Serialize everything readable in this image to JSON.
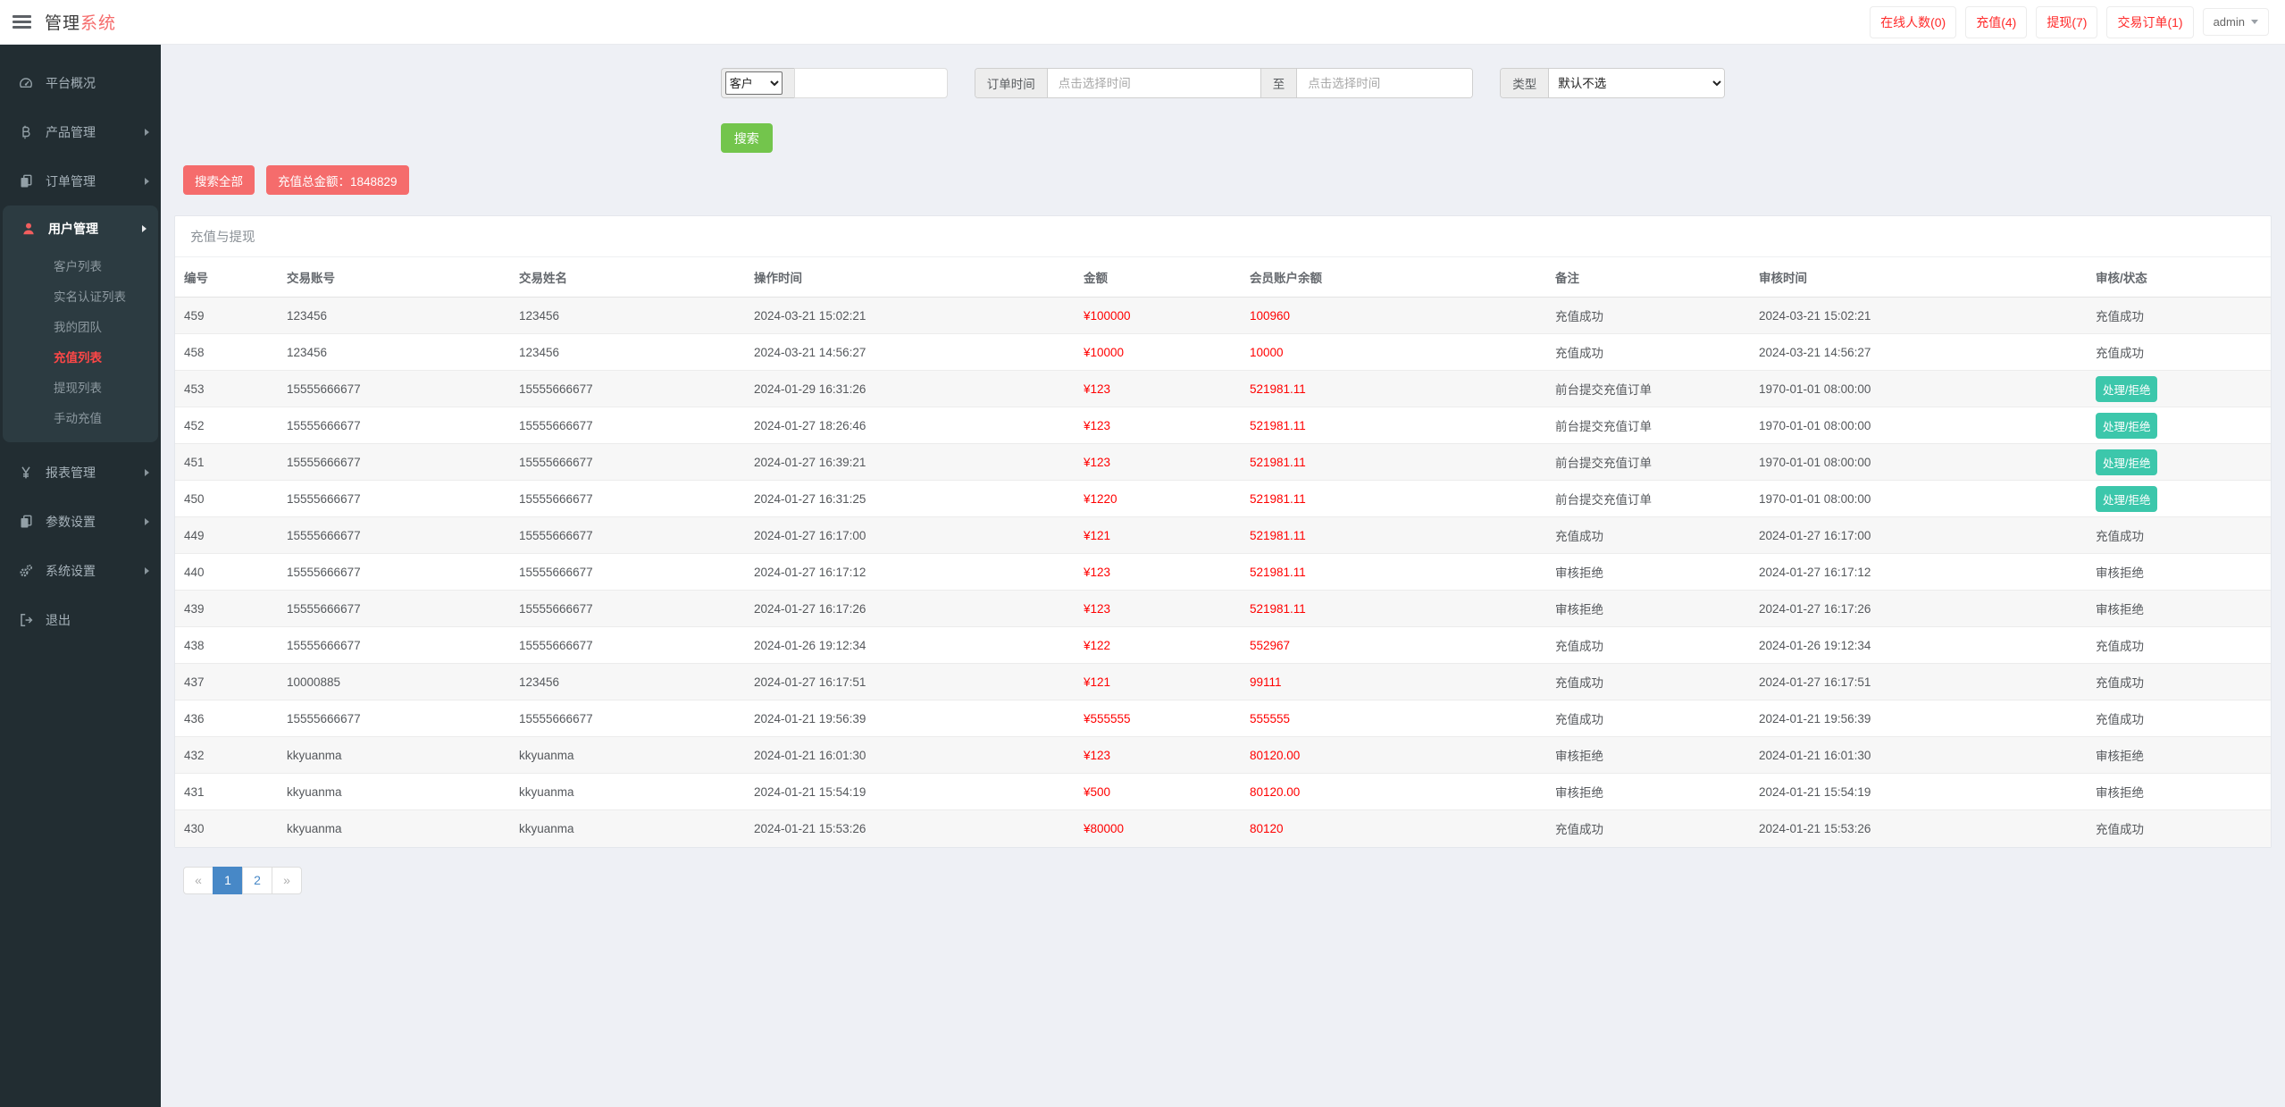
{
  "colors": {
    "brand_red": "#f56c6c",
    "link_red": "#ff2a2a",
    "value_red": "#ff0000",
    "active_red": "#ff4747",
    "green": "#73c54c",
    "teal": "#3cc7ab",
    "blue": "#4788c7",
    "sidebar_bg": "#222d32",
    "sidebar_panel_bg": "#2c3b41",
    "page_bg": "#eef0f5"
  },
  "header": {
    "menu_icon": "hamburger-icon",
    "brand_primary": "管理",
    "brand_accent": "系统",
    "stats": [
      {
        "label": "在线人数(0)"
      },
      {
        "label": "充值(4)"
      },
      {
        "label": "提现(7)"
      },
      {
        "label": "交易订单(1)"
      }
    ],
    "user": {
      "label": "admin",
      "caret_icon": "caret-down-icon"
    }
  },
  "sidebar": {
    "items": [
      {
        "label": "平台概况",
        "icon": "gauge-icon",
        "arrow": false,
        "active": false
      },
      {
        "label": "产品管理",
        "icon": "bitcoin-icon",
        "arrow": true,
        "active": false
      },
      {
        "label": "订单管理",
        "icon": "files-icon",
        "arrow": true,
        "active": false
      },
      {
        "label": "用户管理",
        "icon": "user-icon",
        "arrow": true,
        "active": true,
        "submenu": [
          {
            "label": "客户列表",
            "active": false
          },
          {
            "label": "实名认证列表",
            "active": false
          },
          {
            "label": "我的团队",
            "active": false
          },
          {
            "label": "充值列表",
            "active": true
          },
          {
            "label": "提现列表",
            "active": false
          },
          {
            "label": "手动充值",
            "active": false
          }
        ]
      },
      {
        "label": "报表管理",
        "icon": "yen-icon",
        "arrow": true,
        "active": false
      },
      {
        "label": "参数设置",
        "icon": "copy-icon",
        "arrow": true,
        "active": false
      },
      {
        "label": "系统设置",
        "icon": "gears-icon",
        "arrow": true,
        "active": false
      },
      {
        "label": "退出",
        "icon": "logout-icon",
        "arrow": false,
        "active": false
      }
    ]
  },
  "filters": {
    "customer_select": {
      "selected": "客户"
    },
    "keyword_input": {
      "value": "",
      "placeholder": ""
    },
    "order_time": {
      "label": "订单时间",
      "from_placeholder": "点击选择时间",
      "to_label": "至",
      "to_placeholder": "点击选择时间"
    },
    "type": {
      "label": "类型",
      "selected": "默认不选"
    },
    "search_label": "搜索"
  },
  "actions": {
    "search_all_label": "搜索全部",
    "total_label": "充值总金额：1848829"
  },
  "panel": {
    "title": "充值与提现",
    "table": {
      "columns": [
        "编号",
        "交易账号",
        "交易姓名",
        "操作时间",
        "金额",
        "会员账户余额",
        "备注",
        "审核时间",
        "审核/状态"
      ],
      "rows": [
        {
          "id": "459",
          "account": "123456",
          "name": "123456",
          "op_time": "2024-03-21 15:02:21",
          "amount": "¥100000",
          "balance": "100960",
          "remark": "充值成功",
          "audit_time": "2024-03-21 15:02:21",
          "status": "充值成功",
          "status_type": "text"
        },
        {
          "id": "458",
          "account": "123456",
          "name": "123456",
          "op_time": "2024-03-21 14:56:27",
          "amount": "¥10000",
          "balance": "10000",
          "remark": "充值成功",
          "audit_time": "2024-03-21 14:56:27",
          "status": "充值成功",
          "status_type": "text"
        },
        {
          "id": "453",
          "account": "15555666677",
          "name": "15555666677",
          "op_time": "2024-01-29 16:31:26",
          "amount": "¥123",
          "balance": "521981.11",
          "remark": "前台提交充值订单",
          "audit_time": "1970-01-01 08:00:00",
          "status": "处理/拒绝",
          "status_type": "button"
        },
        {
          "id": "452",
          "account": "15555666677",
          "name": "15555666677",
          "op_time": "2024-01-27 18:26:46",
          "amount": "¥123",
          "balance": "521981.11",
          "remark": "前台提交充值订单",
          "audit_time": "1970-01-01 08:00:00",
          "status": "处理/拒绝",
          "status_type": "button"
        },
        {
          "id": "451",
          "account": "15555666677",
          "name": "15555666677",
          "op_time": "2024-01-27 16:39:21",
          "amount": "¥123",
          "balance": "521981.11",
          "remark": "前台提交充值订单",
          "audit_time": "1970-01-01 08:00:00",
          "status": "处理/拒绝",
          "status_type": "button"
        },
        {
          "id": "450",
          "account": "15555666677",
          "name": "15555666677",
          "op_time": "2024-01-27 16:31:25",
          "amount": "¥1220",
          "balance": "521981.11",
          "remark": "前台提交充值订单",
          "audit_time": "1970-01-01 08:00:00",
          "status": "处理/拒绝",
          "status_type": "button"
        },
        {
          "id": "449",
          "account": "15555666677",
          "name": "15555666677",
          "op_time": "2024-01-27 16:17:00",
          "amount": "¥121",
          "balance": "521981.11",
          "remark": "充值成功",
          "audit_time": "2024-01-27 16:17:00",
          "status": "充值成功",
          "status_type": "text"
        },
        {
          "id": "440",
          "account": "15555666677",
          "name": "15555666677",
          "op_time": "2024-01-27 16:17:12",
          "amount": "¥123",
          "balance": "521981.11",
          "remark": "审核拒绝",
          "audit_time": "2024-01-27 16:17:12",
          "status": "审核拒绝",
          "status_type": "text"
        },
        {
          "id": "439",
          "account": "15555666677",
          "name": "15555666677",
          "op_time": "2024-01-27 16:17:26",
          "amount": "¥123",
          "balance": "521981.11",
          "remark": "审核拒绝",
          "audit_time": "2024-01-27 16:17:26",
          "status": "审核拒绝",
          "status_type": "text"
        },
        {
          "id": "438",
          "account": "15555666677",
          "name": "15555666677",
          "op_time": "2024-01-26 19:12:34",
          "amount": "¥122",
          "balance": "552967",
          "remark": "充值成功",
          "audit_time": "2024-01-26 19:12:34",
          "status": "充值成功",
          "status_type": "text"
        },
        {
          "id": "437",
          "account": "10000885",
          "name": "123456",
          "op_time": "2024-01-27 16:17:51",
          "amount": "¥121",
          "balance": "99111",
          "remark": "充值成功",
          "audit_time": "2024-01-27 16:17:51",
          "status": "充值成功",
          "status_type": "text"
        },
        {
          "id": "436",
          "account": "15555666677",
          "name": "15555666677",
          "op_time": "2024-01-21 19:56:39",
          "amount": "¥555555",
          "balance": "555555",
          "remark": "充值成功",
          "audit_time": "2024-01-21 19:56:39",
          "status": "充值成功",
          "status_type": "text"
        },
        {
          "id": "432",
          "account": "kkyuanma",
          "name": "kkyuanma",
          "op_time": "2024-01-21 16:01:30",
          "amount": "¥123",
          "balance": "80120.00",
          "remark": "审核拒绝",
          "audit_time": "2024-01-21 16:01:30",
          "status": "审核拒绝",
          "status_type": "text"
        },
        {
          "id": "431",
          "account": "kkyuanma",
          "name": "kkyuanma",
          "op_time": "2024-01-21 15:54:19",
          "amount": "¥500",
          "balance": "80120.00",
          "remark": "审核拒绝",
          "audit_time": "2024-01-21 15:54:19",
          "status": "审核拒绝",
          "status_type": "text"
        },
        {
          "id": "430",
          "account": "kkyuanma",
          "name": "kkyuanma",
          "op_time": "2024-01-21 15:53:26",
          "amount": "¥80000",
          "balance": "80120",
          "remark": "充值成功",
          "audit_time": "2024-01-21 15:53:26",
          "status": "充值成功",
          "status_type": "text"
        }
      ]
    },
    "pagination": {
      "prev": "«",
      "pages": [
        {
          "label": "1",
          "active": true
        },
        {
          "label": "2",
          "active": false
        }
      ],
      "next": "»"
    }
  }
}
